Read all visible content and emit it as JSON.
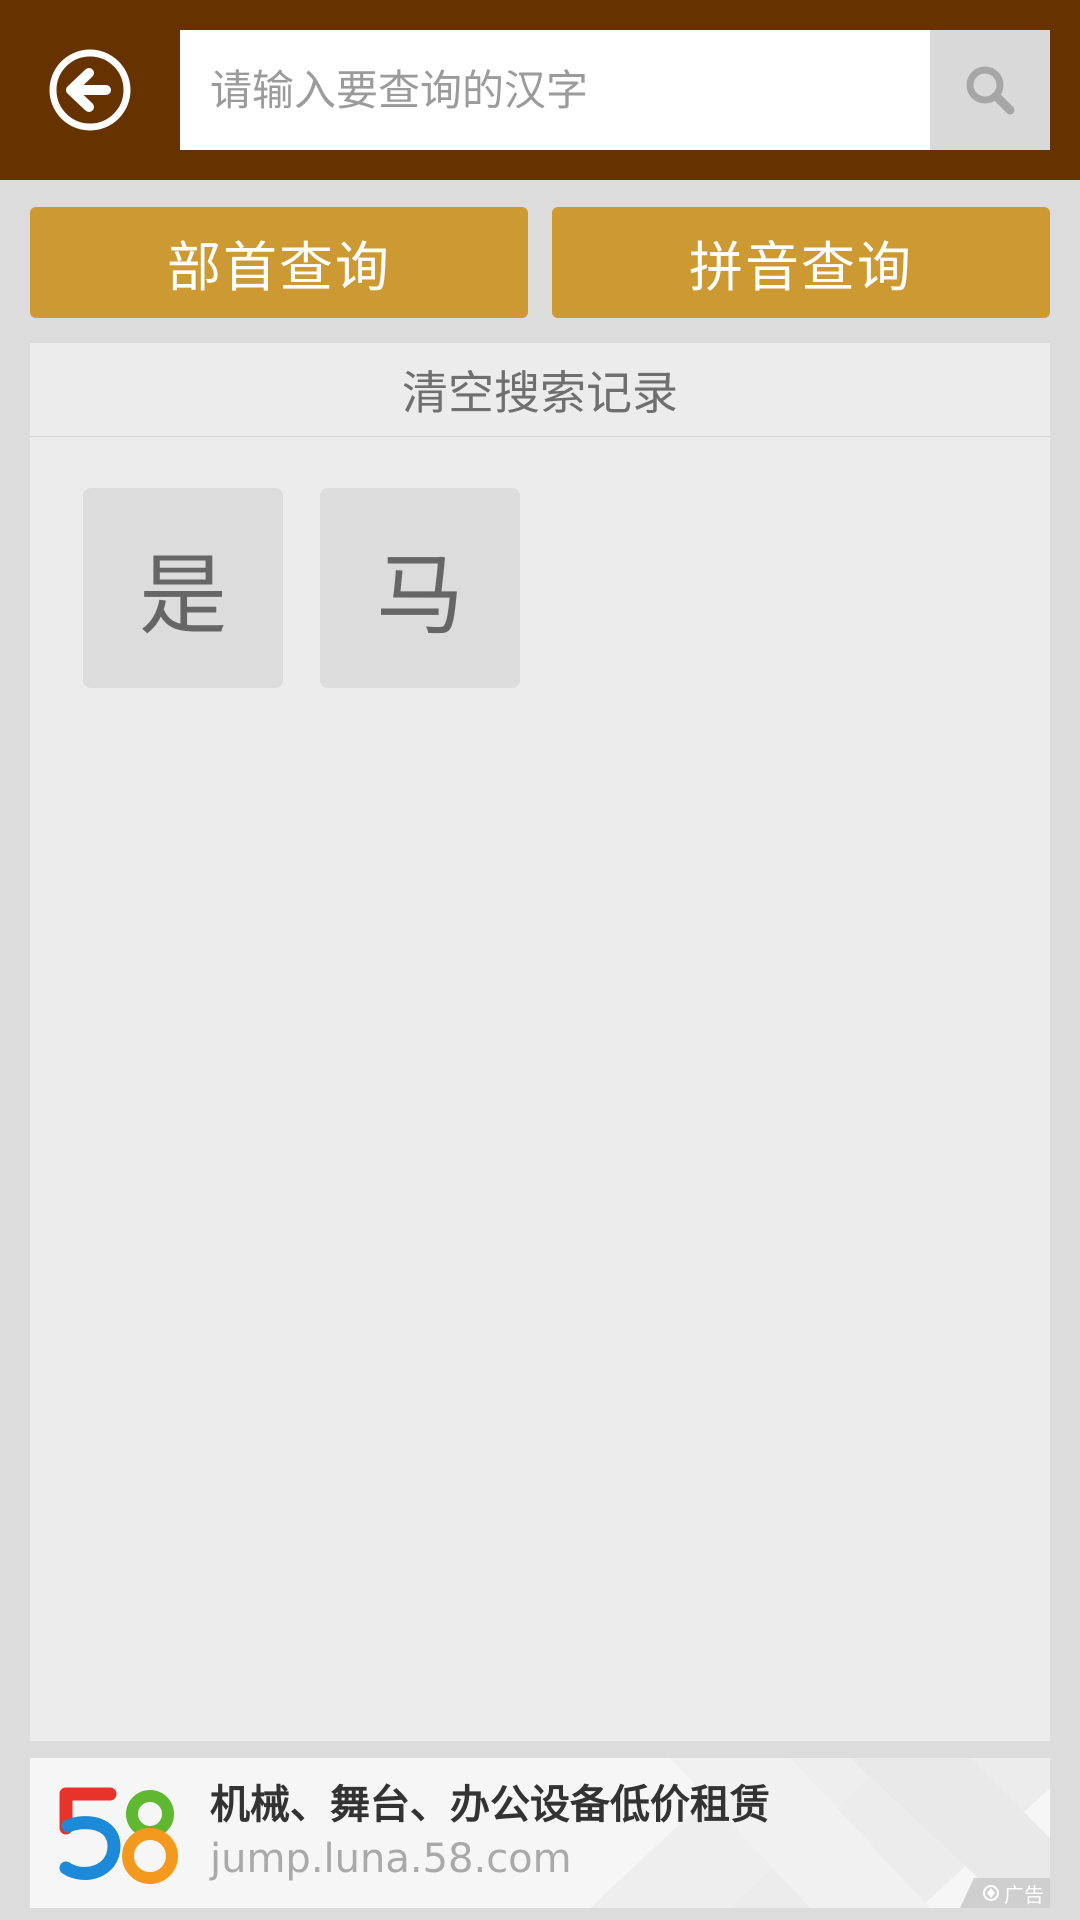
{
  "header": {
    "back_icon": "arrow-left-circle-icon",
    "search": {
      "placeholder": "请输入要查询的汉字",
      "value": "",
      "icon": "search-icon"
    },
    "bar_color": "#663300"
  },
  "query_buttons": {
    "radical": "部首查询",
    "pinyin": "拼音查询",
    "color": "#cc9933"
  },
  "history": {
    "clear_label": "清空搜索记录",
    "items": [
      "是",
      "马"
    ]
  },
  "ad": {
    "title": "机械、舞台、办公设备低价租赁",
    "url": "jump.luna.58.com",
    "badge": "广告",
    "logo": "58-logo"
  }
}
